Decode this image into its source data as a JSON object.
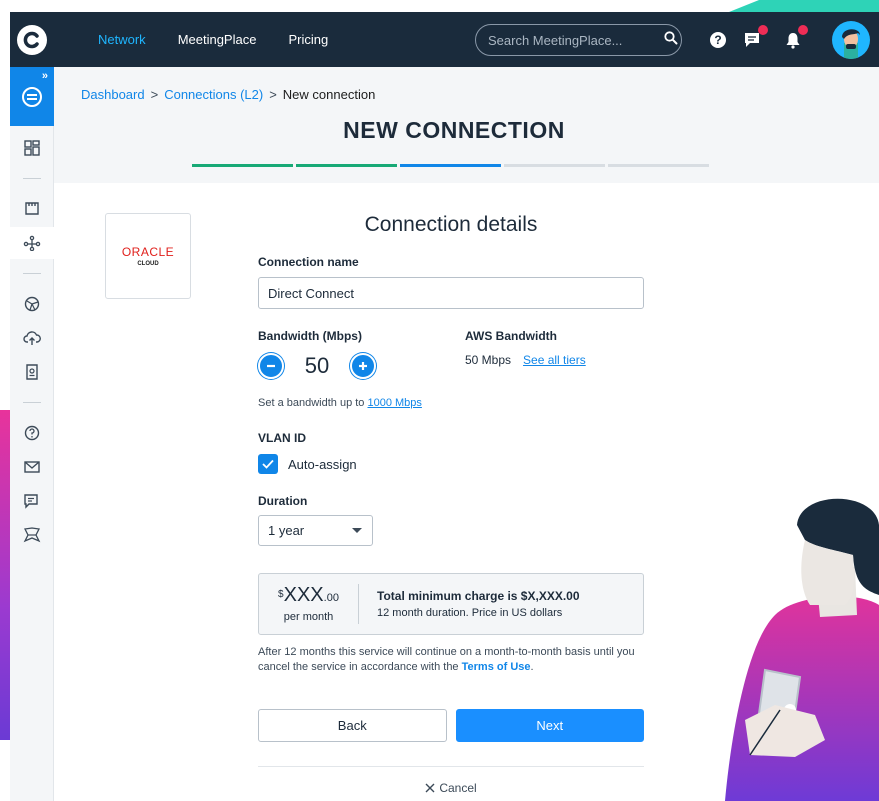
{
  "topbar": {
    "nav": [
      "Network",
      "MeetingPlace",
      "Pricing"
    ],
    "search_placeholder": "Search MeetingPlace...",
    "help_label": "?"
  },
  "breadcrumb": {
    "dashboard": "Dashboard",
    "connections": "Connections (L2)",
    "current": "New connection",
    "separator": ">"
  },
  "page_title": "NEW CONNECTION",
  "progress": {
    "total_steps": 5,
    "completed_steps": 2,
    "current_step": 3
  },
  "provider": {
    "name": "ORACLE",
    "sub": "CLOUD"
  },
  "form": {
    "title": "Connection details",
    "connection_name_label": "Connection name",
    "connection_name_value": "Direct Connect",
    "bandwidth_label": "Bandwidth (Mbps)",
    "bandwidth_value": "50",
    "aws_bandwidth_label": "AWS Bandwidth",
    "aws_bandwidth_value": "50 Mbps",
    "see_all_tiers": "See all tiers",
    "bandwidth_hint": "Set a bandwidth up to",
    "bandwidth_hint_link": "1000 Mbps",
    "vlan_label": "VLAN ID",
    "auto_assign_label": "Auto-assign",
    "duration_label": "Duration",
    "duration_value": "1 year"
  },
  "price": {
    "currency": "$",
    "amount": "XXX",
    "cents": ".00",
    "period": "per month",
    "total": "Total minimum charge is $X,XXX.00",
    "note": "12 month duration. Price in US dollars"
  },
  "terms": {
    "text": "After 12 months this service will continue on a month-to-month basis until you cancel the service in accordance with the",
    "link": "Terms of Use",
    "end": "."
  },
  "buttons": {
    "back": "Back",
    "next": "Next",
    "cancel": "Cancel"
  },
  "colors": {
    "primary": "#1086e8",
    "nav_bg": "#1a2b3c",
    "step_done": "#17a976",
    "oracle_red": "#e0201c",
    "alert": "#ef2d56"
  }
}
